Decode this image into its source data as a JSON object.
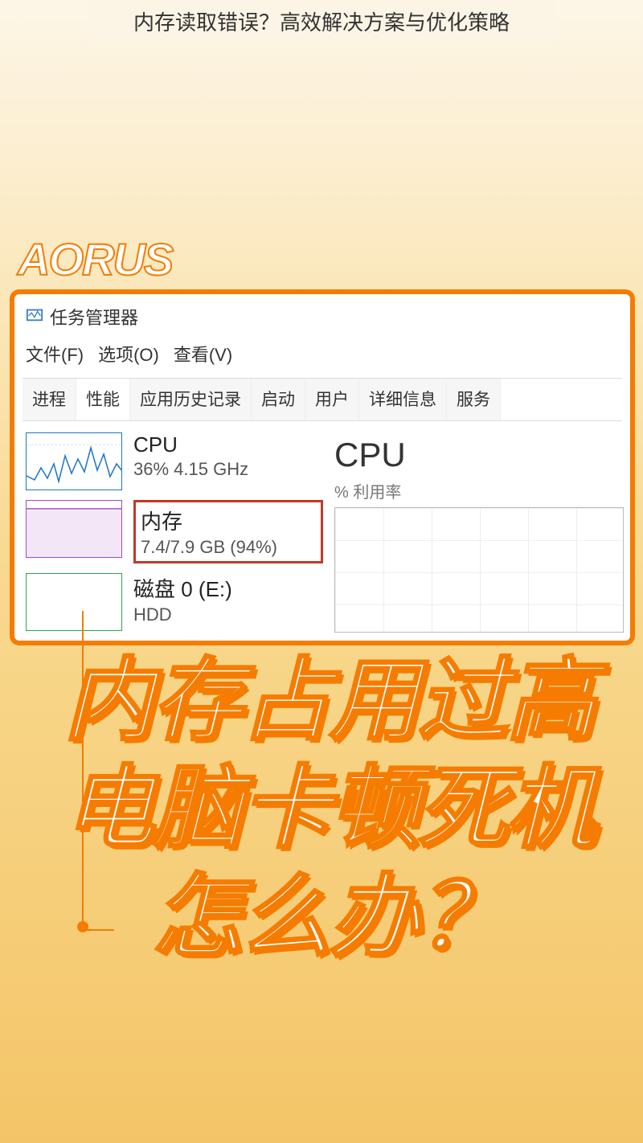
{
  "page": {
    "title": "内存读取错误？高效解决方案与优化策略"
  },
  "brand": "AORUS",
  "taskmgr": {
    "windowTitle": "任务管理器",
    "menu": {
      "file": "文件(F)",
      "options": "选项(O)",
      "view": "查看(V)"
    },
    "tabs": [
      "进程",
      "性能",
      "应用历史记录",
      "启动",
      "用户",
      "详细信息",
      "服务"
    ],
    "activeTabIndex": 1,
    "metrics": {
      "cpu": {
        "title": "CPU",
        "sub": "36% 4.15 GHz"
      },
      "memory": {
        "title": "内存",
        "sub": "7.4/7.9 GB (94%)"
      },
      "disk": {
        "title": "磁盘 0 (E:)",
        "sub": "HDD"
      }
    },
    "detail": {
      "title": "CPU",
      "utilLabel": "% 利用率"
    }
  },
  "headline": {
    "line1": "内存占用过高",
    "line2": "电脑卡顿死机",
    "line3": "怎么办？"
  },
  "chart_data": {
    "type": "line",
    "title": "CPU 利用率",
    "ylabel": "% 利用率",
    "ylim": [
      0,
      100
    ],
    "x": [],
    "values": []
  }
}
